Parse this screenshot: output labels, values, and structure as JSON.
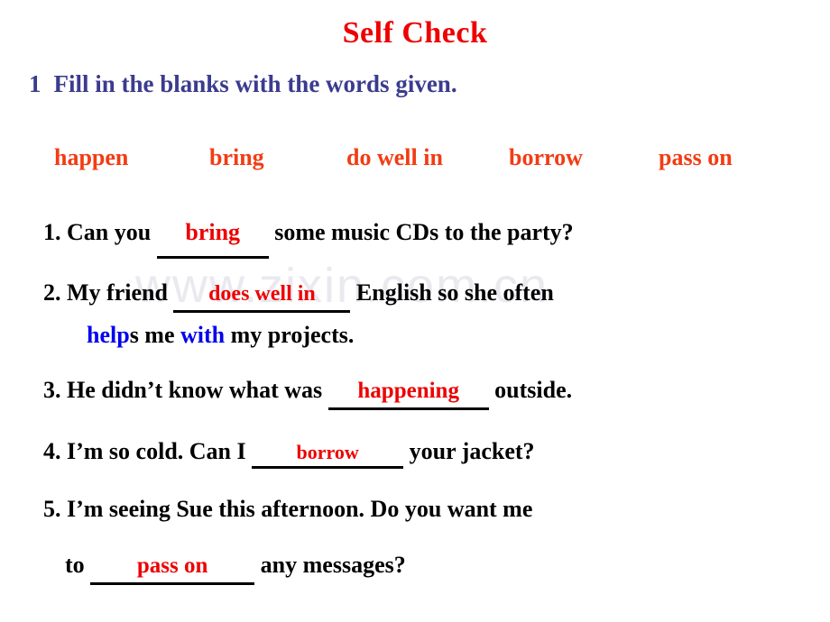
{
  "slide": {
    "title": "Self Check",
    "watermark": "www.zixin.com.cn",
    "colors": {
      "title_red": "#ee0000",
      "wordbank_orange": "#f23c14",
      "heading_navy": "#3b3b8f",
      "answer_red": "#ee0000",
      "highlight_blue": "#0000ee",
      "body_black": "#000000",
      "watermark_gray": "#e9e9ef",
      "background": "#ffffff"
    }
  },
  "instruction": {
    "number": "1",
    "text": "Fill in the blanks with the words given."
  },
  "word_bank": {
    "words": [
      "happen",
      "bring",
      "do well in",
      "borrow",
      "pass on"
    ]
  },
  "questions": [
    {
      "number": "1.",
      "before": "Can you",
      "answer": "bring",
      "after": "some music CDs to the party?"
    },
    {
      "number": "2.",
      "before": "My friend",
      "answer": "does well in",
      "after": "English so she often",
      "line2": {
        "blue1": "help",
        "black1": "s me",
        "blue2": "with",
        "black2": "my projects."
      }
    },
    {
      "number": "3.",
      "before": "He didn’t know what was",
      "answer": "happening",
      "after": "outside."
    },
    {
      "number": "4.",
      "before": "I’m so cold. Can I",
      "answer": "borrow",
      "after": "your jacket?"
    },
    {
      "number": "5.",
      "before": "I’m seeing Sue this afternoon. Do you want me",
      "line2_before": "to",
      "answer": "pass on",
      "line2_after": "any messages?"
    }
  ]
}
